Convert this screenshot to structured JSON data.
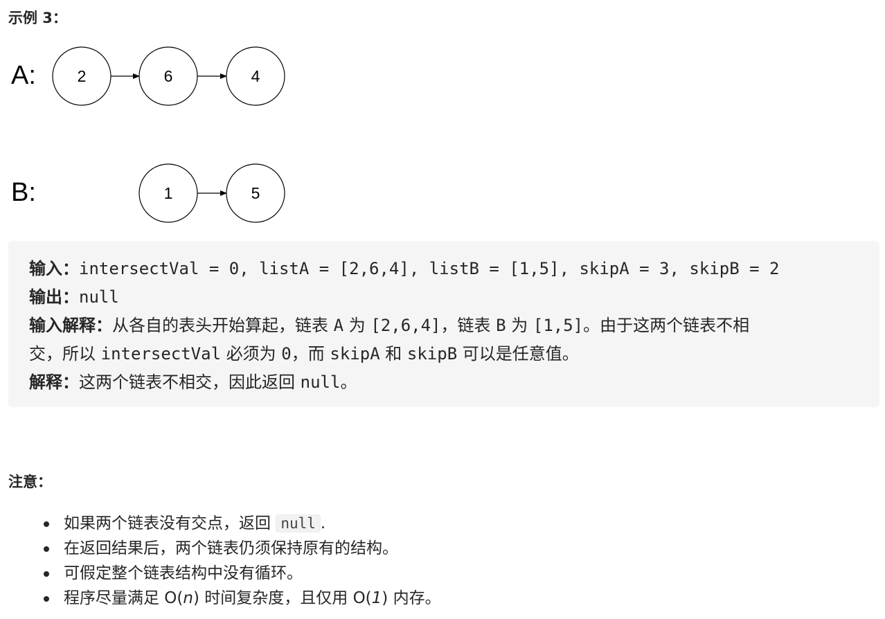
{
  "example": {
    "heading": "示例 3："
  },
  "diagram": {
    "list_a": {
      "label": "A:",
      "nodes": [
        "2",
        "6",
        "4"
      ]
    },
    "list_b": {
      "label": "B:",
      "nodes": [
        "1",
        "5"
      ]
    }
  },
  "io": {
    "input_label": "输入：",
    "input_text": "intersectVal = 0, listA = [2,6,4], listB = [1,5], skipA = 3, skipB = 2",
    "output_label": "输出：",
    "output_text": "null",
    "input_explain_label": "输入解释：",
    "input_explain_p1": "从各自的表头开始算起，链表 ",
    "input_explain_c1": "A",
    "input_explain_p2": " 为 ",
    "input_explain_c2": "[2,6,4]",
    "input_explain_p3": "，链表 ",
    "input_explain_c3": "B",
    "input_explain_p4": " 为 ",
    "input_explain_c4": "[1,5]",
    "input_explain_p5": "。由于这两个链表不相",
    "input_explain_p6": "交，所以 ",
    "input_explain_c5": "intersectVal",
    "input_explain_p7": " 必须为 ",
    "input_explain_c6": "0",
    "input_explain_p8": "，而 ",
    "input_explain_c7": "skipA",
    "input_explain_p9": " 和 ",
    "input_explain_c8": "skipB",
    "input_explain_p10": " 可以是任意值。",
    "explain_label": "解释：",
    "explain_p1": "这两个链表不相交，因此返回 ",
    "explain_c1": "null",
    "explain_p2": "。"
  },
  "notes": {
    "heading": "注意：",
    "item1_text": "如果两个链表没有交点，返回 ",
    "item1_code": "null",
    "item1_end": ".",
    "item2_text": "在返回结果后，两个链表仍须保持原有的结构。",
    "item3_text": "可假定整个链表结构中没有循环。",
    "item4_p1": "程序尽量满足 O(",
    "item4_n": "n",
    "item4_p2": ") 时间复杂度，且仅用 O(",
    "item4_one": "1",
    "item4_p3": ") 内存。"
  }
}
